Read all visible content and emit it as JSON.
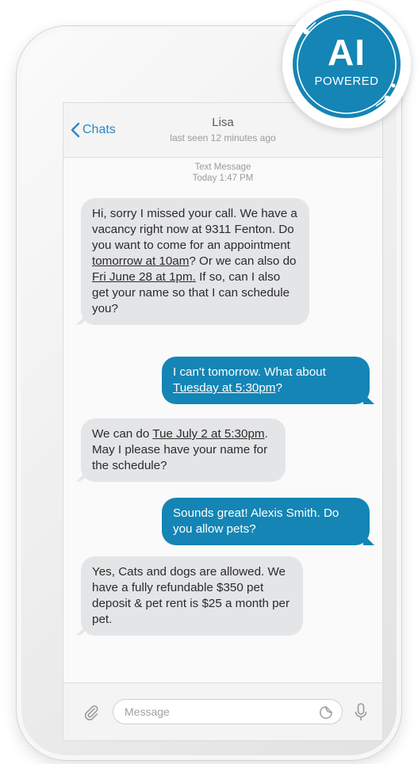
{
  "header": {
    "back_label": "Chats",
    "contact_name": "Lisa",
    "contact_status": "last seen 12 minutes ago"
  },
  "conversation_meta": {
    "type": "Text Message",
    "time": "Today 1:47 PM"
  },
  "messages": [
    {
      "direction": "incoming",
      "parts": [
        "Hi, sorry I missed your call. We have a vacancy right now at 9311 Fenton. Do you want to come for an appointment ",
        "tomorrow at 10am",
        "? Or we can also do ",
        "Fri June 28 at 1pm.",
        " If so, can I also get your name so that I can schedule you?"
      ]
    },
    {
      "direction": "outgoing",
      "parts": [
        "I can't tomorrow. What about ",
        "Tuesday at 5:30pm",
        "?"
      ]
    },
    {
      "direction": "incoming",
      "parts": [
        "We can do ",
        "Tue July 2 at 5:30pm",
        ". May I please have your name for the schedule?"
      ]
    },
    {
      "direction": "outgoing",
      "text": "Sounds great! Alexis Smith. Do you allow pets?"
    },
    {
      "direction": "incoming",
      "text": "Yes, Cats and dogs are allowed. We have a fully refundable $350 pet deposit & pet rent is $25 a month per pet."
    }
  ],
  "composer": {
    "placeholder": "Message",
    "attach_icon": "paperclip-icon",
    "sticker_icon": "sticker-icon",
    "mic_icon": "microphone-icon"
  },
  "badge": {
    "title": "AI",
    "subtitle": "POWERED",
    "color": "#1485b5"
  },
  "colors": {
    "accent": "#2d86c9",
    "outgoing_bubble": "#1485b5",
    "incoming_bubble": "#e4e5e7"
  }
}
